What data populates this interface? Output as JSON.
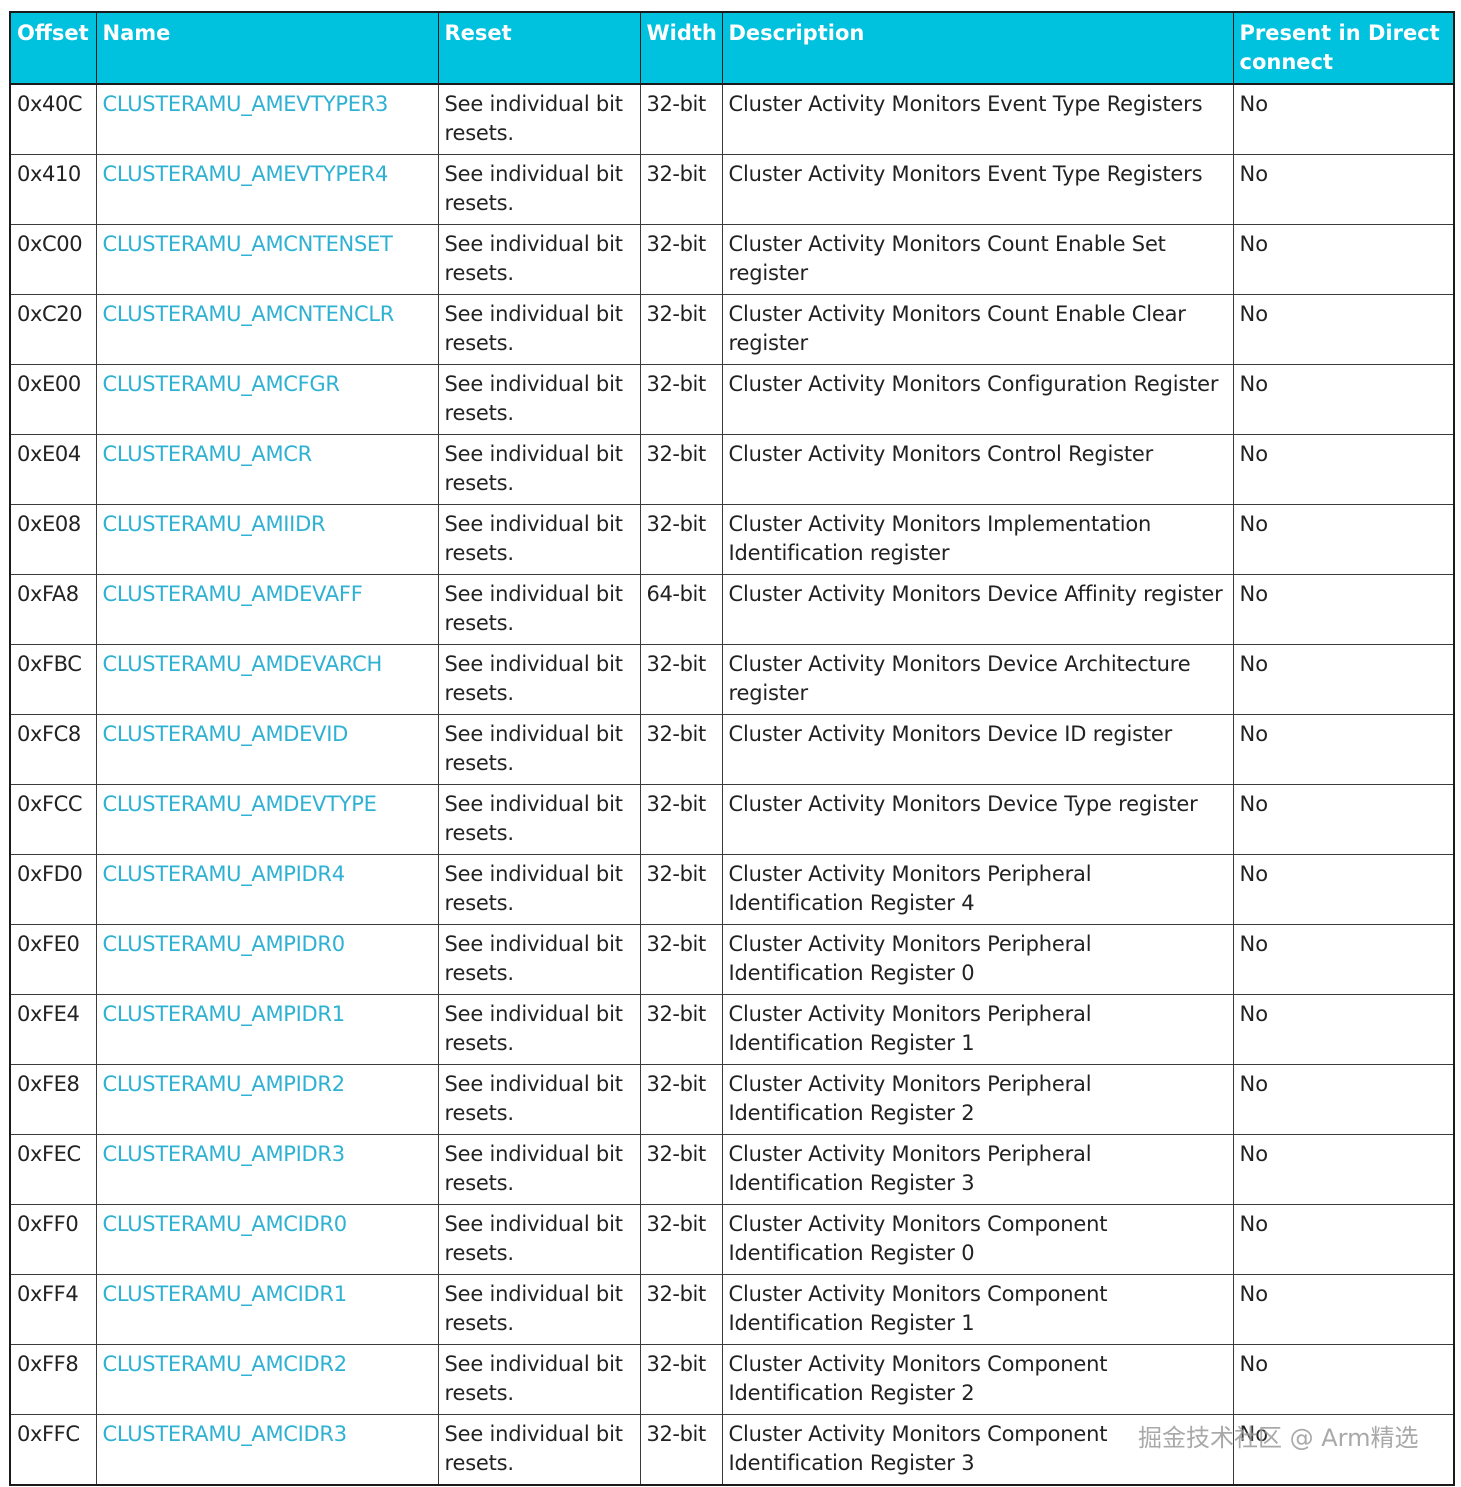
{
  "table": {
    "headers": {
      "offset": "Offset",
      "name": "Name",
      "reset": "Reset",
      "width": "Width",
      "description": "Description",
      "present": "Present in Direct connect"
    },
    "rows": [
      {
        "offset": "0x40C",
        "name": "CLUSTERAMU_AMEVTYPER3",
        "reset": "See individual bit resets.",
        "width": "32-bit",
        "description": "Cluster Activity Monitors Event Type Registers",
        "present": "No"
      },
      {
        "offset": "0x410",
        "name": "CLUSTERAMU_AMEVTYPER4",
        "reset": "See individual bit resets.",
        "width": "32-bit",
        "description": "Cluster Activity Monitors Event Type Registers",
        "present": "No"
      },
      {
        "offset": "0xC00",
        "name": "CLUSTERAMU_AMCNTENSET",
        "reset": "See individual bit resets.",
        "width": "32-bit",
        "description": "Cluster Activity Monitors Count Enable Set register",
        "present": "No"
      },
      {
        "offset": "0xC20",
        "name": "CLUSTERAMU_AMCNTENCLR",
        "reset": "See individual bit resets.",
        "width": "32-bit",
        "description": "Cluster Activity Monitors Count Enable Clear register",
        "present": "No"
      },
      {
        "offset": "0xE00",
        "name": "CLUSTERAMU_AMCFGR",
        "reset": "See individual bit resets.",
        "width": "32-bit",
        "description": "Cluster Activity Monitors Configuration Register",
        "present": "No"
      },
      {
        "offset": "0xE04",
        "name": "CLUSTERAMU_AMCR",
        "reset": "See individual bit resets.",
        "width": "32-bit",
        "description": "Cluster Activity Monitors Control Register",
        "present": "No"
      },
      {
        "offset": "0xE08",
        "name": "CLUSTERAMU_AMIIDR",
        "reset": "See individual bit resets.",
        "width": "32-bit",
        "description": "Cluster Activity Monitors Implementation Identification register",
        "present": "No"
      },
      {
        "offset": "0xFA8",
        "name": "CLUSTERAMU_AMDEVAFF",
        "reset": "See individual bit resets.",
        "width": "64-bit",
        "description": "Cluster Activity Monitors Device Affinity register",
        "present": "No"
      },
      {
        "offset": "0xFBC",
        "name": "CLUSTERAMU_AMDEVARCH",
        "reset": "See individual bit resets.",
        "width": "32-bit",
        "description": "Cluster Activity Monitors Device Architecture register",
        "present": "No"
      },
      {
        "offset": "0xFC8",
        "name": "CLUSTERAMU_AMDEVID",
        "reset": "See individual bit resets.",
        "width": "32-bit",
        "description": "Cluster Activity Monitors Device ID register",
        "present": "No"
      },
      {
        "offset": "0xFCC",
        "name": "CLUSTERAMU_AMDEVTYPE",
        "reset": "See individual bit resets.",
        "width": "32-bit",
        "description": "Cluster Activity Monitors Device Type register",
        "present": "No"
      },
      {
        "offset": "0xFD0",
        "name": "CLUSTERAMU_AMPIDR4",
        "reset": "See individual bit resets.",
        "width": "32-bit",
        "description": "Cluster Activity Monitors Peripheral Identification Register 4",
        "present": "No"
      },
      {
        "offset": "0xFE0",
        "name": "CLUSTERAMU_AMPIDR0",
        "reset": "See individual bit resets.",
        "width": "32-bit",
        "description": "Cluster Activity Monitors Peripheral Identification Register 0",
        "present": "No"
      },
      {
        "offset": "0xFE4",
        "name": "CLUSTERAMU_AMPIDR1",
        "reset": "See individual bit resets.",
        "width": "32-bit",
        "description": "Cluster Activity Monitors Peripheral Identification Register 1",
        "present": "No"
      },
      {
        "offset": "0xFE8",
        "name": "CLUSTERAMU_AMPIDR2",
        "reset": "See individual bit resets.",
        "width": "32-bit",
        "description": "Cluster Activity Monitors Peripheral Identification Register 2",
        "present": "No"
      },
      {
        "offset": "0xFEC",
        "name": "CLUSTERAMU_AMPIDR3",
        "reset": "See individual bit resets.",
        "width": "32-bit",
        "description": "Cluster Activity Monitors Peripheral Identification Register 3",
        "present": "No"
      },
      {
        "offset": "0xFF0",
        "name": "CLUSTERAMU_AMCIDR0",
        "reset": "See individual bit resets.",
        "width": "32-bit",
        "description": "Cluster Activity Monitors Component Identification Register 0",
        "present": "No"
      },
      {
        "offset": "0xFF4",
        "name": "CLUSTERAMU_AMCIDR1",
        "reset": "See individual bit resets.",
        "width": "32-bit",
        "description": "Cluster Activity Monitors Component Identification Register 1",
        "present": "No"
      },
      {
        "offset": "0xFF8",
        "name": "CLUSTERAMU_AMCIDR2",
        "reset": "See individual bit resets.",
        "width": "32-bit",
        "description": "Cluster Activity Monitors Component Identification Register 2",
        "present": "No"
      },
      {
        "offset": "0xFFC",
        "name": "CLUSTERAMU_AMCIDR3",
        "reset": "See individual bit resets.",
        "width": "32-bit",
        "description": "Cluster Activity Monitors Component Identification Register 3",
        "present": "No"
      }
    ]
  },
  "watermark": "掘金技术社区 @ Arm精选",
  "colors": {
    "header_background": "#00c1de",
    "header_text": "#ffffff",
    "link": "#2fb1d3",
    "border": "#1a1a1a"
  }
}
